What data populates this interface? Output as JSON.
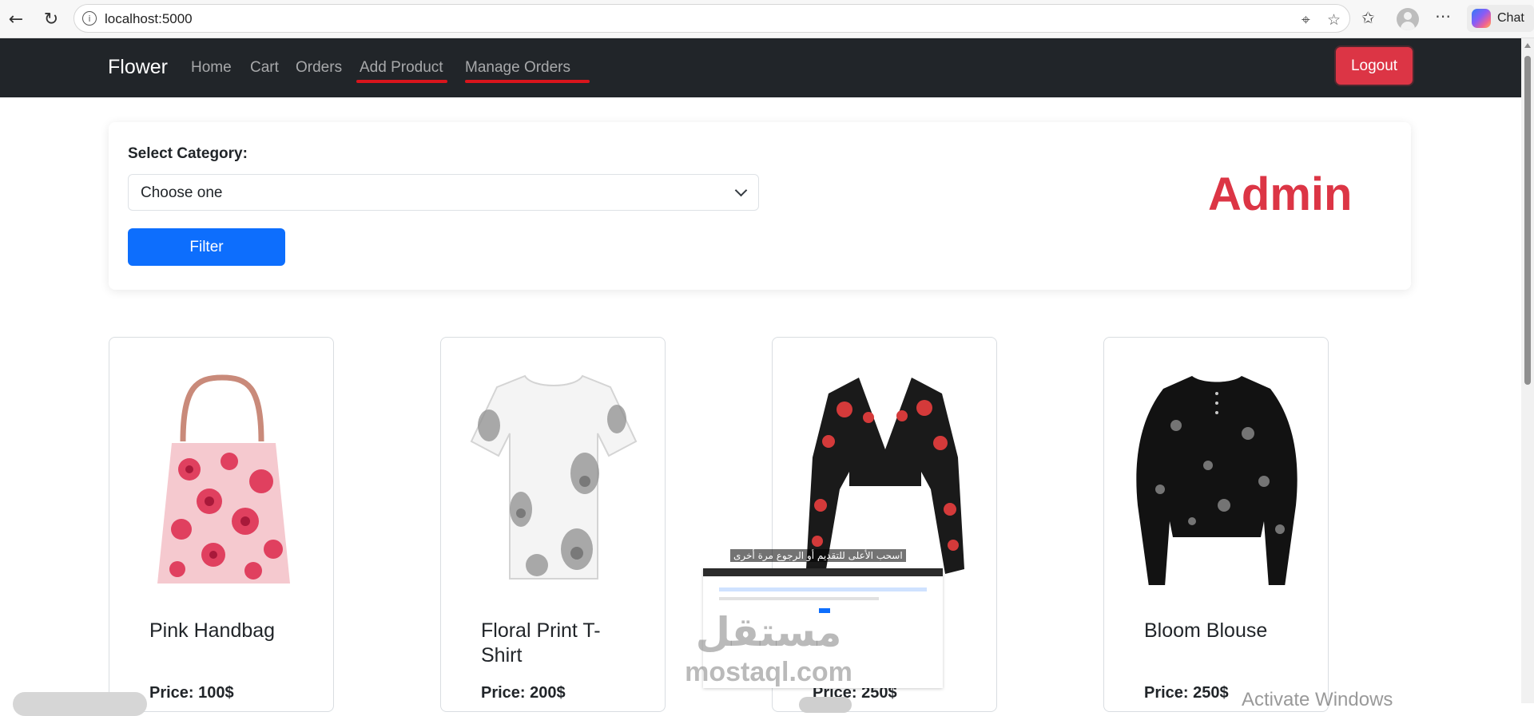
{
  "browser": {
    "url": "localhost:5000",
    "chat_label": "Chat"
  },
  "navbar": {
    "brand": "Flower",
    "links": [
      {
        "label": "Home"
      },
      {
        "label": "Cart"
      },
      {
        "label": "Orders"
      },
      {
        "label": "Add Product",
        "highlighted": true
      },
      {
        "label": "Manage Orders",
        "highlighted": true
      }
    ],
    "logout_label": "Logout",
    "highlight_color": "#d9151c"
  },
  "filter": {
    "label": "Select Category:",
    "selected": "Choose one",
    "button_label": "Filter"
  },
  "role_label": "Admin",
  "products": [
    {
      "name": "Pink Handbag",
      "price": "Price: 100$"
    },
    {
      "name": "Floral Print T-Shirt",
      "price": "Price: 200$"
    },
    {
      "name": "",
      "price": "Price: 250$"
    },
    {
      "name": "Bloom Blouse",
      "price": "Price: 250$"
    }
  ],
  "overlays": {
    "watermark_arabic": "مستقل",
    "watermark_site": "mostaql.com",
    "os_notice": "Activate Windows",
    "thumbnail_caption": "اسحب الأعلى للتقديم أو الرجوع مرة أخرى"
  },
  "colors": {
    "navbar_bg": "#212529",
    "logout": "#dc3545",
    "filter_button": "#0d6efd",
    "admin_text": "#dc3545"
  }
}
